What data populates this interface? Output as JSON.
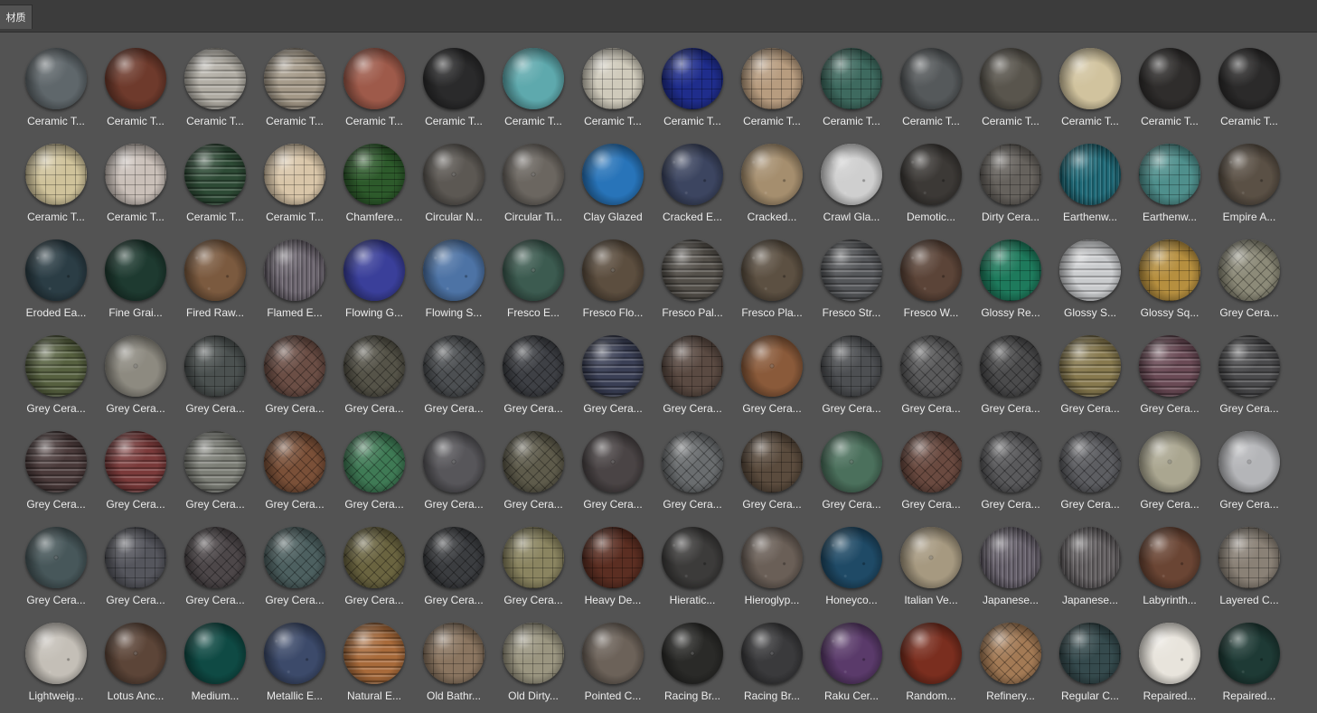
{
  "panel": {
    "tab_label": "材质"
  },
  "materials": [
    {
      "label": "Ceramic T...",
      "color": "#5f676b",
      "pattern": "plain"
    },
    {
      "label": "Ceramic T...",
      "color": "#6e3a2c",
      "pattern": "plain"
    },
    {
      "label": "Ceramic T...",
      "color": "#b0aca3",
      "pattern": "hlines"
    },
    {
      "label": "Ceramic T...",
      "color": "#a39887",
      "pattern": "hlines"
    },
    {
      "label": "Ceramic T...",
      "color": "#9e5a4a",
      "pattern": "plain"
    },
    {
      "label": "Ceramic T...",
      "color": "#2a2a2b",
      "pattern": "plain"
    },
    {
      "label": "Ceramic T...",
      "color": "#5ea9ad",
      "pattern": "plain"
    },
    {
      "label": "Ceramic T...",
      "color": "#cfcabb",
      "pattern": "grid"
    },
    {
      "label": "Ceramic T...",
      "color": "#1f2d8c",
      "pattern": "grid"
    },
    {
      "label": "Ceramic T...",
      "color": "#b79c7f",
      "pattern": "grid"
    },
    {
      "label": "Ceramic T...",
      "color": "#3e6a5f",
      "pattern": "grid"
    },
    {
      "label": "Ceramic T...",
      "color": "#55595b",
      "pattern": "plain"
    },
    {
      "label": "Ceramic T...",
      "color": "#59554d",
      "pattern": "plain"
    },
    {
      "label": "Ceramic T...",
      "color": "#d1c39e",
      "pattern": "plain"
    },
    {
      "label": "Ceramic T...",
      "color": "#2f2d2c",
      "pattern": "plain"
    },
    {
      "label": "Ceramic T...",
      "color": "#2b2a2a",
      "pattern": "plain"
    },
    {
      "label": "Ceramic T...",
      "color": "#cfc29a",
      "pattern": "grid"
    },
    {
      "label": "Ceramic T...",
      "color": "#c9bfb8",
      "pattern": "grid"
    },
    {
      "label": "Ceramic T...",
      "color": "#2d4a35",
      "pattern": "hlines"
    },
    {
      "label": "Ceramic T...",
      "color": "#d8c5a8",
      "pattern": "grid"
    },
    {
      "label": "Chamfere...",
      "color": "#2d5a2b",
      "pattern": "brick"
    },
    {
      "label": "Circular N...",
      "color": "#5c5853",
      "pattern": "dots"
    },
    {
      "label": "Circular Ti...",
      "color": "#6b6660",
      "pattern": "dots"
    },
    {
      "label": "Clay Glazed",
      "color": "#2874b9",
      "pattern": "plain"
    },
    {
      "label": "Cracked E...",
      "color": "#3c4560",
      "pattern": "noise"
    },
    {
      "label": "Cracked...",
      "color": "#a58e6e",
      "pattern": "noise"
    },
    {
      "label": "Crawl Gla...",
      "color": "#cfcfcf",
      "pattern": "noise"
    },
    {
      "label": "Demotic...",
      "color": "#3c3936",
      "pattern": "noise"
    },
    {
      "label": "Dirty Cera...",
      "color": "#66625d",
      "pattern": "grid"
    },
    {
      "label": "Earthenw...",
      "color": "#1f6a78",
      "pattern": "vlines"
    },
    {
      "label": "Earthenw...",
      "color": "#4f8f8c",
      "pattern": "grid"
    },
    {
      "label": "Empire A...",
      "color": "#5a5045",
      "pattern": "noise"
    },
    {
      "label": "Eroded Ea...",
      "color": "#2b3d45",
      "pattern": "noise"
    },
    {
      "label": "Fine Grai...",
      "color": "#1e3a30",
      "pattern": "plain"
    },
    {
      "label": "Fired Raw...",
      "color": "#7b5a3f",
      "pattern": "noise"
    },
    {
      "label": "Flamed E...",
      "color": "#6d6670",
      "pattern": "vlines"
    },
    {
      "label": "Flowing G...",
      "color": "#3a3f9a",
      "pattern": "plain"
    },
    {
      "label": "Flowing S...",
      "color": "#4d73a5",
      "pattern": "noise"
    },
    {
      "label": "Fresco E...",
      "color": "#3c5b50",
      "pattern": "dots"
    },
    {
      "label": "Fresco Flo...",
      "color": "#5c4e3f",
      "pattern": "dots"
    },
    {
      "label": "Fresco Pal...",
      "color": "#54504a",
      "pattern": "hlines"
    },
    {
      "label": "Fresco Pla...",
      "color": "#5c5042",
      "pattern": "noise"
    },
    {
      "label": "Fresco Str...",
      "color": "#55575a",
      "pattern": "hlines"
    },
    {
      "label": "Fresco W...",
      "color": "#5b4438",
      "pattern": "noise"
    },
    {
      "label": "Glossy Re...",
      "color": "#1e7a5c",
      "pattern": "grid"
    },
    {
      "label": "Glossy S...",
      "color": "#c9cbcd",
      "pattern": "hlines"
    },
    {
      "label": "Glossy Sq...",
      "color": "#b68f3f",
      "pattern": "grid"
    },
    {
      "label": "Grey Cera...",
      "color": "#8c8a78",
      "pattern": "diamond"
    },
    {
      "label": "Grey Cera...",
      "color": "#56603f",
      "pattern": "hlines"
    },
    {
      "label": "Grey Cera...",
      "color": "#8d8a80",
      "pattern": "dots"
    },
    {
      "label": "Grey Cera...",
      "color": "#4b5150",
      "pattern": "grid"
    },
    {
      "label": "Grey Cera...",
      "color": "#6b4e45",
      "pattern": "diamond"
    },
    {
      "label": "Grey Cera...",
      "color": "#555348",
      "pattern": "diamond"
    },
    {
      "label": "Grey Cera...",
      "color": "#4c4f52",
      "pattern": "diamond"
    },
    {
      "label": "Grey Cera...",
      "color": "#3e4045",
      "pattern": "diamond"
    },
    {
      "label": "Grey Cera...",
      "color": "#3a3f55",
      "pattern": "hlines"
    },
    {
      "label": "Grey Cera...",
      "color": "#5a4a42",
      "pattern": "grid"
    },
    {
      "label": "Grey Cera...",
      "color": "#8a5a3a",
      "pattern": "dots"
    },
    {
      "label": "Grey Cera...",
      "color": "#4d4f52",
      "pattern": "grid"
    },
    {
      "label": "Grey Cera...",
      "color": "#5a5a5b",
      "pattern": "diamond"
    },
    {
      "label": "Grey Cera...",
      "color": "#4b4b4c",
      "pattern": "diamond"
    },
    {
      "label": "Grey Cera...",
      "color": "#87794e",
      "pattern": "hlines"
    },
    {
      "label": "Grey Cera...",
      "color": "#6a4a55",
      "pattern": "hlines"
    },
    {
      "label": "Grey Cera...",
      "color": "#4a4a4c",
      "pattern": "hlines"
    },
    {
      "label": "Grey Cera...",
      "color": "#4a3a3a",
      "pattern": "hlines"
    },
    {
      "label": "Grey Cera...",
      "color": "#7a3a3a",
      "pattern": "hlines"
    },
    {
      "label": "Grey Cera...",
      "color": "#7c7e76",
      "pattern": "hlines"
    },
    {
      "label": "Grey Cera...",
      "color": "#7a5038",
      "pattern": "diamond"
    },
    {
      "label": "Grey Cera...",
      "color": "#3f7a55",
      "pattern": "diamond"
    },
    {
      "label": "Grey Cera...",
      "color": "#57565a",
      "pattern": "dots"
    },
    {
      "label": "Grey Cera...",
      "color": "#5e5b4b",
      "pattern": "diamond"
    },
    {
      "label": "Grey Cera...",
      "color": "#4a4445",
      "pattern": "dots"
    },
    {
      "label": "Grey Cera...",
      "color": "#6a6d6f",
      "pattern": "diamond"
    },
    {
      "label": "Grey Cera...",
      "color": "#5a4b3d",
      "pattern": "grid"
    },
    {
      "label": "Grey Cera...",
      "color": "#4b705c",
      "pattern": "dots"
    },
    {
      "label": "Grey Cera...",
      "color": "#6a4a40",
      "pattern": "diamond"
    },
    {
      "label": "Grey Cera...",
      "color": "#5a5a5c",
      "pattern": "diamond"
    },
    {
      "label": "Grey Cera...",
      "color": "#5d5e62",
      "pattern": "diamond"
    },
    {
      "label": "Grey Cera...",
      "color": "#aaa690",
      "pattern": "dots"
    },
    {
      "label": "Grey Cera...",
      "color": "#b4b5b8",
      "pattern": "dots"
    },
    {
      "label": "Grey Cera...",
      "color": "#47575a",
      "pattern": "dots"
    },
    {
      "label": "Grey Cera...",
      "color": "#55565d",
      "pattern": "grid"
    },
    {
      "label": "Grey Cera...",
      "color": "#4d4749",
      "pattern": "diamond"
    },
    {
      "label": "Grey Cera...",
      "color": "#4d6060",
      "pattern": "diamond"
    },
    {
      "label": "Grey Cera...",
      "color": "#6a6440",
      "pattern": "diamond"
    },
    {
      "label": "Grey Cera...",
      "color": "#3b3d40",
      "pattern": "diamond"
    },
    {
      "label": "Grey Cera...",
      "color": "#8a8460",
      "pattern": "grid"
    },
    {
      "label": "Heavy De...",
      "color": "#5b2e22",
      "pattern": "grid"
    },
    {
      "label": "Hieratic...",
      "color": "#3c3b3a",
      "pattern": "noise"
    },
    {
      "label": "Hieroglyp...",
      "color": "#6a5f57",
      "pattern": "noise"
    },
    {
      "label": "Honeyco...",
      "color": "#1f4a66",
      "pattern": "noise"
    },
    {
      "label": "Italian Ve...",
      "color": "#a69980",
      "pattern": "dots"
    },
    {
      "label": "Japanese...",
      "color": "#68626d",
      "pattern": "vlines"
    },
    {
      "label": "Japanese...",
      "color": "#646062",
      "pattern": "vlines"
    },
    {
      "label": "Labyrinth...",
      "color": "#6a4534",
      "pattern": "noise"
    },
    {
      "label": "Layered C...",
      "color": "#8a8176",
      "pattern": "grid"
    },
    {
      "label": "Lightweig...",
      "color": "#c4bfb7",
      "pattern": "noise"
    },
    {
      "label": "Lotus Anc...",
      "color": "#5c4538",
      "pattern": "dots"
    },
    {
      "label": "Medium...",
      "color": "#0f4a44",
      "pattern": "plain"
    },
    {
      "label": "Metallic E...",
      "color": "#3c4a6a",
      "pattern": "noise"
    },
    {
      "label": "Natural E...",
      "color": "#a86a3a",
      "pattern": "hlines"
    },
    {
      "label": "Old Bathr...",
      "color": "#8a7560",
      "pattern": "grid"
    },
    {
      "label": "Old Dirty...",
      "color": "#9a9580",
      "pattern": "grid"
    },
    {
      "label": "Pointed C...",
      "color": "#6c6259",
      "pattern": "plain"
    },
    {
      "label": "Racing Br...",
      "color": "#2a2a28",
      "pattern": "dots"
    },
    {
      "label": "Racing Br...",
      "color": "#3a3a3c",
      "pattern": "dots"
    },
    {
      "label": "Raku Cer...",
      "color": "#5a3a6a",
      "pattern": "noise"
    },
    {
      "label": "Random...",
      "color": "#7a2e1f",
      "pattern": "plain"
    },
    {
      "label": "Refinery...",
      "color": "#a37a55",
      "pattern": "diamond"
    },
    {
      "label": "Regular C...",
      "color": "#354a4d",
      "pattern": "grid"
    },
    {
      "label": "Repaired...",
      "color": "#e8e4dc",
      "pattern": "noise"
    },
    {
      "label": "Repaired...",
      "color": "#1e3a35",
      "pattern": "noise"
    }
  ]
}
